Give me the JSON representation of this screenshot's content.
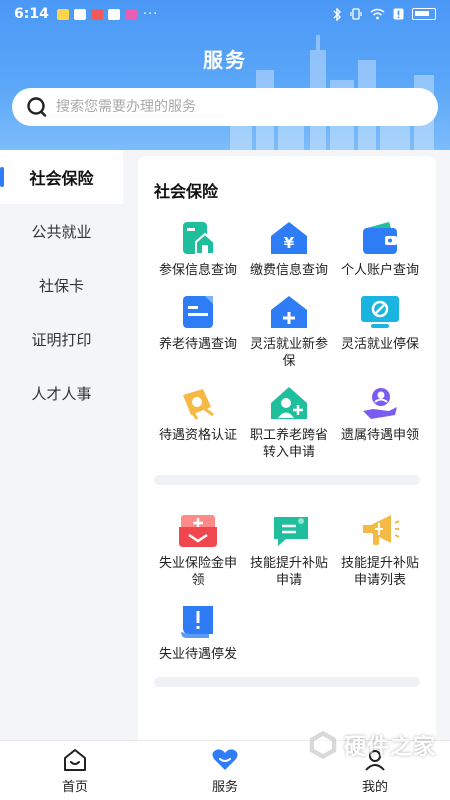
{
  "status_bar": {
    "time": "6:14",
    "dots": "···"
  },
  "header": {
    "title": "服务"
  },
  "search": {
    "placeholder": "搜索您需要办理的服务"
  },
  "sidebar": {
    "items": [
      {
        "label": "社会保险",
        "active": true
      },
      {
        "label": "公共就业",
        "active": false
      },
      {
        "label": "社保卡",
        "active": false
      },
      {
        "label": "证明打印",
        "active": false
      },
      {
        "label": "人才人事",
        "active": false
      }
    ]
  },
  "panel": {
    "section_title": "社会保险",
    "group1": [
      {
        "label": "参保信息查询",
        "icon": "insurance-info-icon"
      },
      {
        "label": "缴费信息查询",
        "icon": "payment-info-icon"
      },
      {
        "label": "个人账户查询",
        "icon": "wallet-icon"
      },
      {
        "label": "养老待遇查询",
        "icon": "pension-document-icon"
      },
      {
        "label": "灵活就业新参保",
        "icon": "house-plus-icon"
      },
      {
        "label": "灵活就业停保",
        "icon": "stop-monitor-icon"
      },
      {
        "label": "待遇资格认证",
        "icon": "verification-icon"
      },
      {
        "label": "职工养老跨省转入申请",
        "icon": "transfer-people-icon"
      },
      {
        "label": "遗属待遇申领",
        "icon": "survivor-icon"
      }
    ],
    "group2": [
      {
        "label": "失业保险金申领",
        "icon": "unemployment-benefit-icon"
      },
      {
        "label": "技能提升补贴申请",
        "icon": "chat-bubble-icon"
      },
      {
        "label": "技能提升补贴申请列表",
        "icon": "megaphone-icon"
      },
      {
        "label": "失业待遇停发",
        "icon": "alert-flag-icon"
      }
    ]
  },
  "bottom_nav": [
    {
      "label": "首页",
      "icon": "home-icon"
    },
    {
      "label": "服务",
      "icon": "heart-icon"
    },
    {
      "label": "我的",
      "icon": "person-icon"
    }
  ],
  "watermark": {
    "text": "硬件之家"
  },
  "colors": {
    "primary": "#2f7df6",
    "teal": "#1fbf9e",
    "red": "#f0464f",
    "yellow": "#f5b945",
    "purple": "#7a5cf0"
  }
}
